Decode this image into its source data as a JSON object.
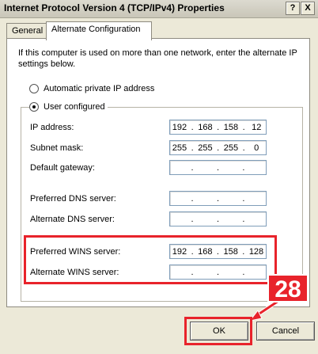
{
  "window": {
    "title": "Internet Protocol Version 4 (TCP/IPv4) Properties",
    "help": "?",
    "close": "X"
  },
  "tabs": [
    "General",
    "Alternate Configuration"
  ],
  "description": "If this computer is used on more than one network, enter the alternate IP settings below.",
  "options": {
    "automatic": "Automatic private IP address",
    "user": "User configured"
  },
  "fields": [
    {
      "label": "IP address:",
      "octets": [
        "192",
        "168",
        "158",
        "12"
      ]
    },
    {
      "label": "Subnet mask:",
      "octets": [
        "255",
        "255",
        "255",
        "0"
      ]
    },
    {
      "label": "Default gateway:",
      "octets": [
        "",
        "",
        "",
        ""
      ]
    },
    {
      "label": "Preferred DNS server:",
      "octets": [
        "",
        "",
        "",
        ""
      ]
    },
    {
      "label": "Alternate DNS server:",
      "octets": [
        "",
        "",
        "",
        ""
      ]
    },
    {
      "label": "Preferred WINS server:",
      "octets": [
        "192",
        "168",
        "158",
        "128"
      ]
    },
    {
      "label": "Alternate WINS server:",
      "octets": [
        "",
        "",
        "",
        ""
      ]
    }
  ],
  "buttons": {
    "ok": "OK",
    "cancel": "Cancel"
  },
  "annotation": {
    "step": "28",
    "color": "#e8232b"
  }
}
